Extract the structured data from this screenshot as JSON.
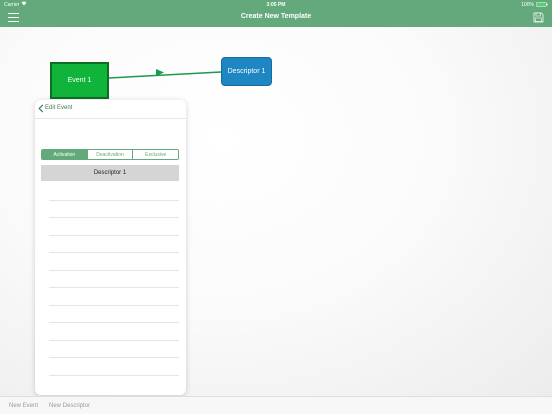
{
  "status": {
    "carrier": "Carrier",
    "time": "3:05 PM",
    "battery": "100%"
  },
  "nav": {
    "title": "Create New Template"
  },
  "canvas": {
    "event_node": {
      "label": "Event 1"
    },
    "descriptor_node": {
      "label": "Descriptor 1"
    }
  },
  "popover": {
    "title": "Edit Event",
    "segments": [
      "Activation",
      "Deactivation",
      "Exclusive"
    ],
    "selected_segment": "Activation",
    "selected_row": "Descriptor 1"
  },
  "toolbar": {
    "new_event": "New Event",
    "new_descriptor": "New Descriptor"
  },
  "colors": {
    "accent": "#64a97c",
    "event_node": "#10b43a",
    "descriptor_node": "#1f86c4",
    "connector": "#1a9a4a"
  }
}
